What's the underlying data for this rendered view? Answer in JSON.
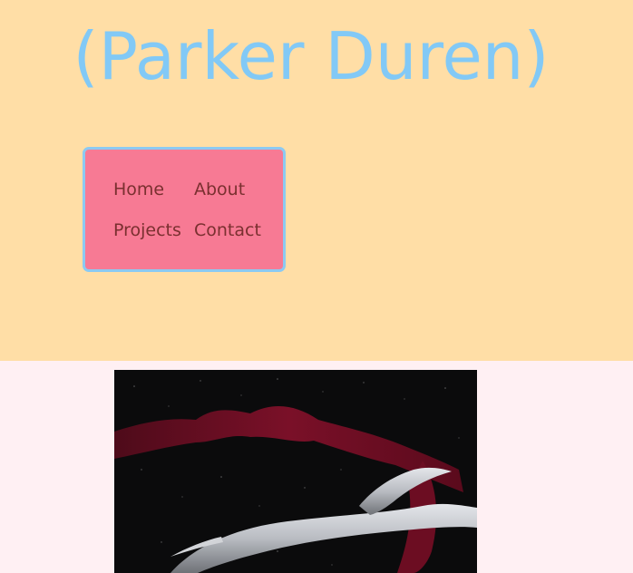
{
  "site": {
    "title": "(Parker Duren)"
  },
  "nav": {
    "items": [
      {
        "label": "Home"
      },
      {
        "label": "About"
      },
      {
        "label": "Projects"
      },
      {
        "label": "Contact"
      }
    ]
  },
  "colors": {
    "header_background": "#ffdea6",
    "title_color": "#82c9f6",
    "nav_background": "#f77a94",
    "nav_border": "#8ccaf2",
    "nav_link_color": "#7a3030",
    "content_background": "#fff0f3"
  }
}
